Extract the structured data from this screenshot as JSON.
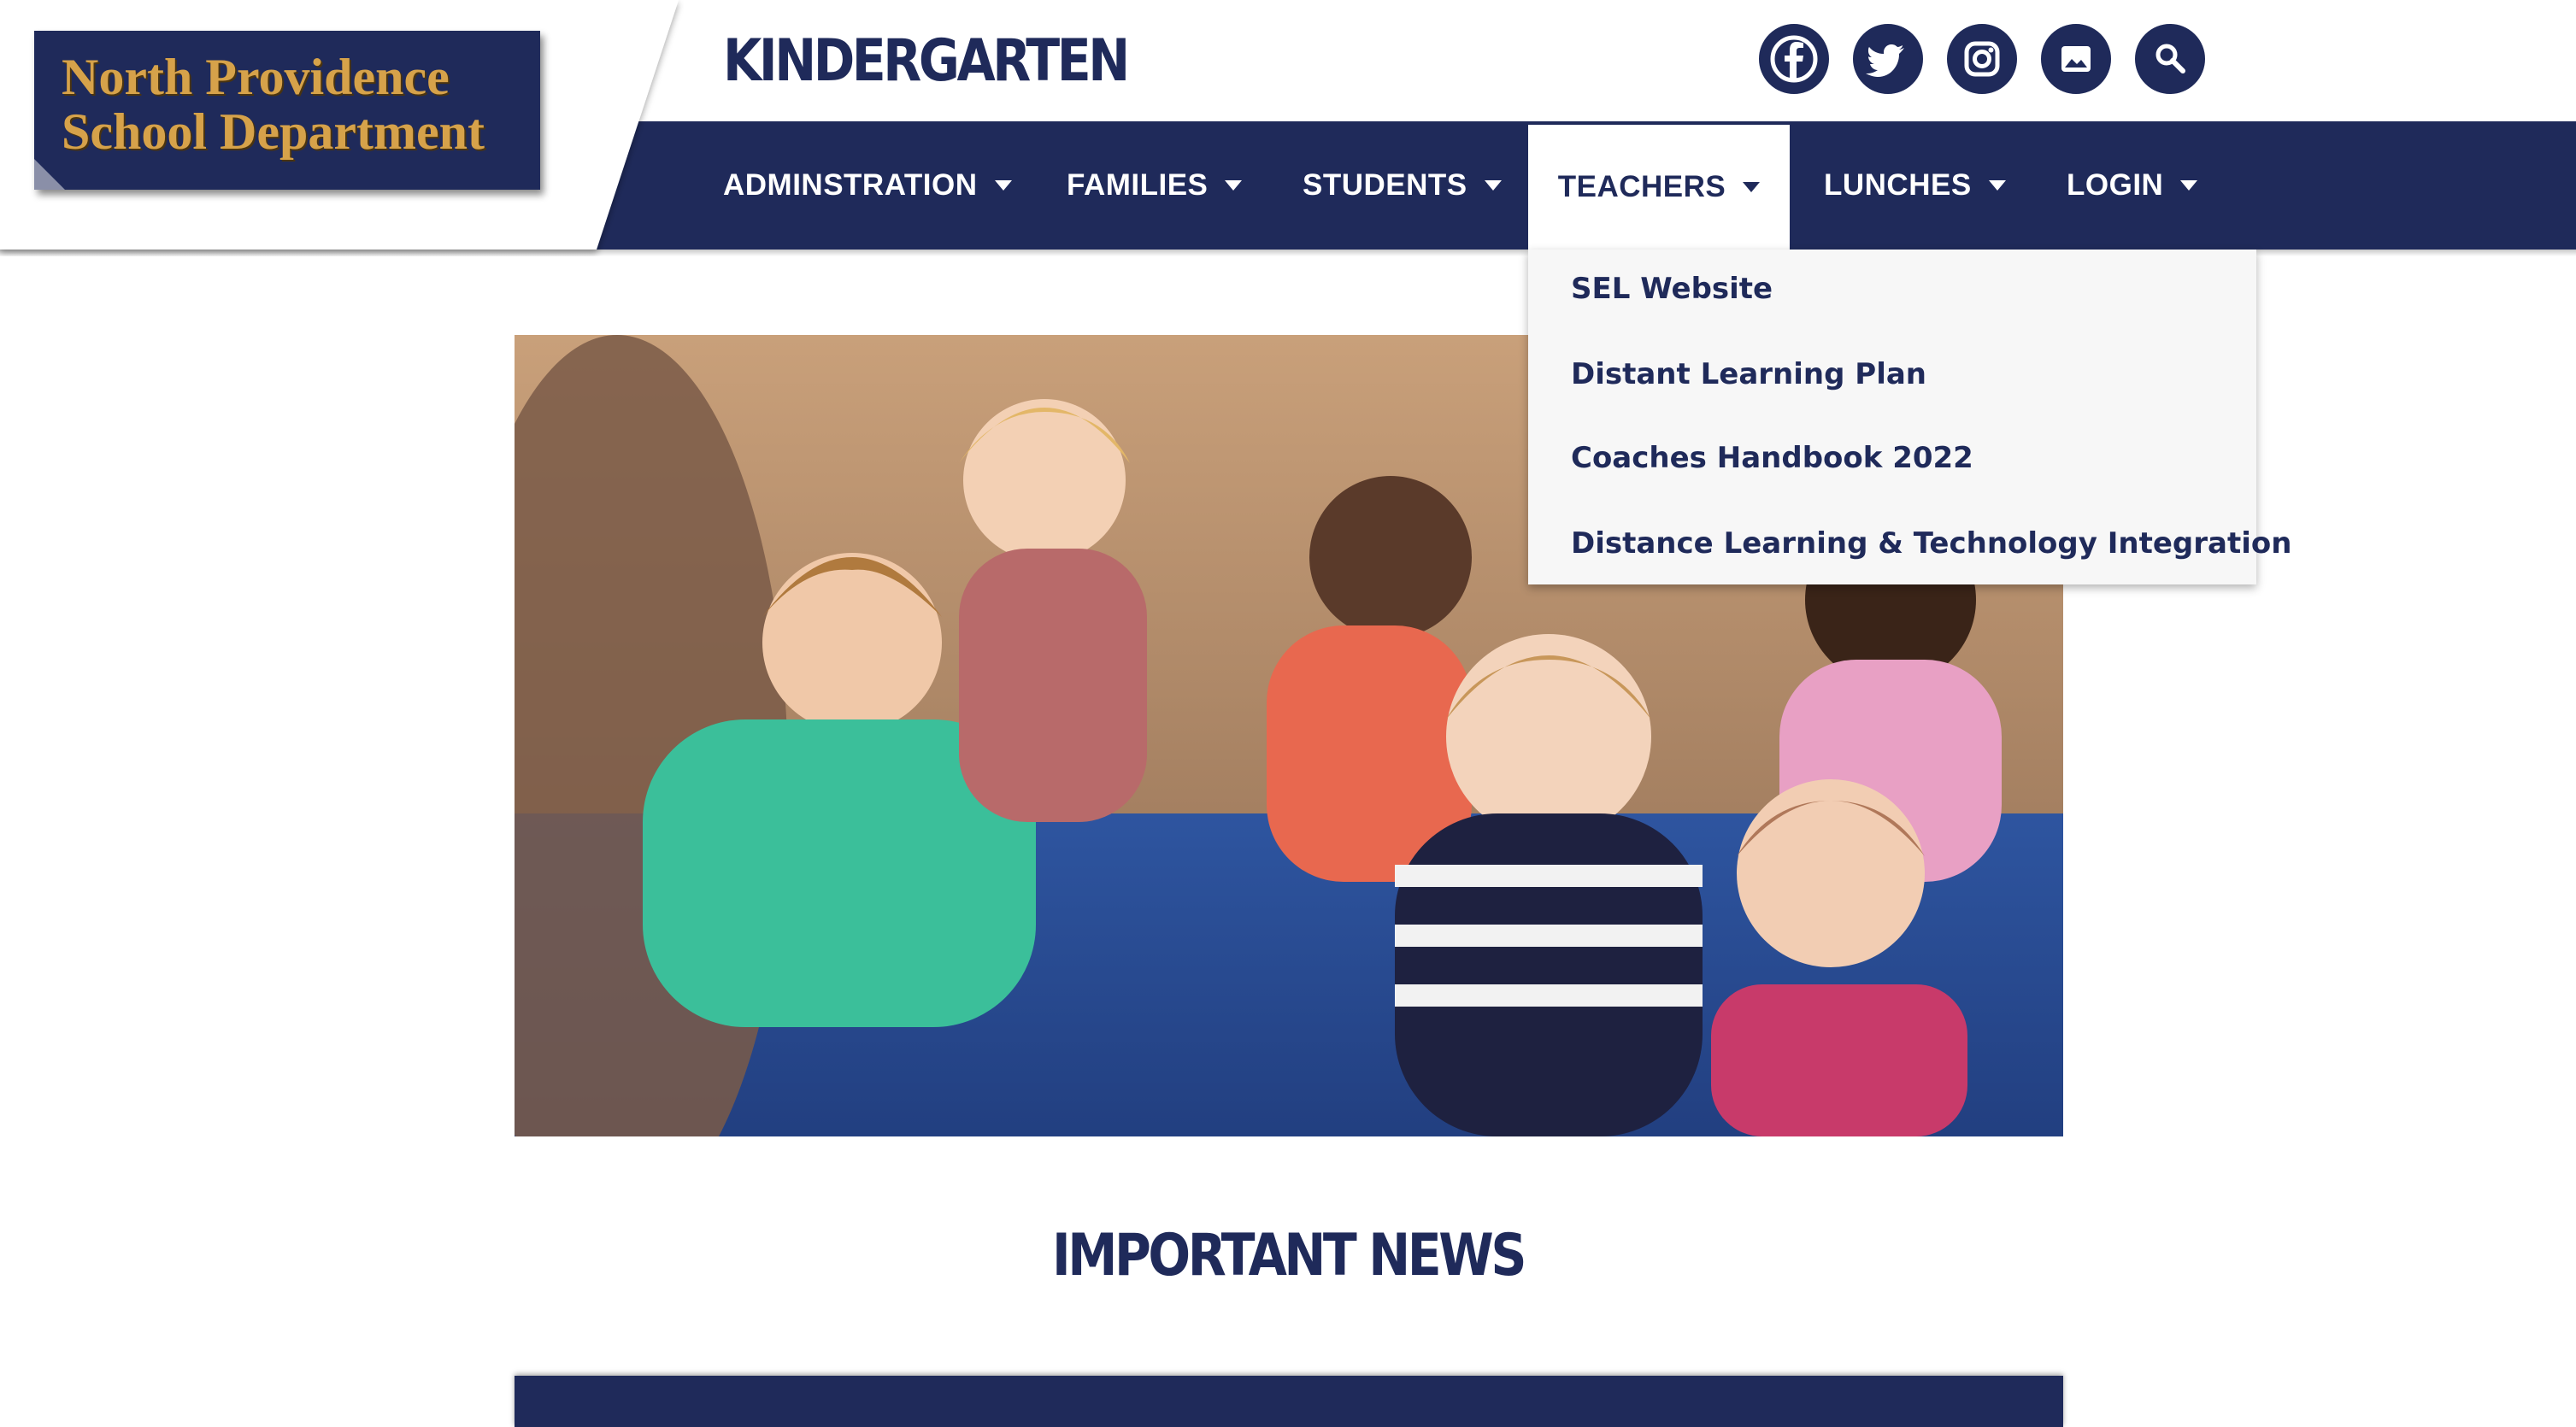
{
  "logo": {
    "line1": "North Providence",
    "line2": "School Department"
  },
  "page_title": "KINDERGARTEN",
  "social": [
    {
      "name": "facebook-icon"
    },
    {
      "name": "twitter-icon"
    },
    {
      "name": "instagram-icon"
    },
    {
      "name": "gallery-icon"
    },
    {
      "name": "search-icon"
    }
  ],
  "nav": {
    "items": [
      {
        "label": "ADMINSTRATION"
      },
      {
        "label": "FAMILIES"
      },
      {
        "label": "STUDENTS"
      },
      {
        "label": "TEACHERS"
      },
      {
        "label": "LUNCHES"
      },
      {
        "label": "LOGIN"
      }
    ],
    "active": "TEACHERS"
  },
  "dropdown": {
    "items": [
      {
        "label": "SEL Website"
      },
      {
        "label": "Distant Learning Plan"
      },
      {
        "label": "Coaches Handbook 2022"
      },
      {
        "label": "Distance Learning & Technology Integration"
      }
    ]
  },
  "main": {
    "section_heading": "IMPORTANT NEWS"
  },
  "colors": {
    "brand": "#1f2a5a",
    "logo_text": "#d6a24a",
    "dropdown_bg": "#f7f7f7"
  }
}
